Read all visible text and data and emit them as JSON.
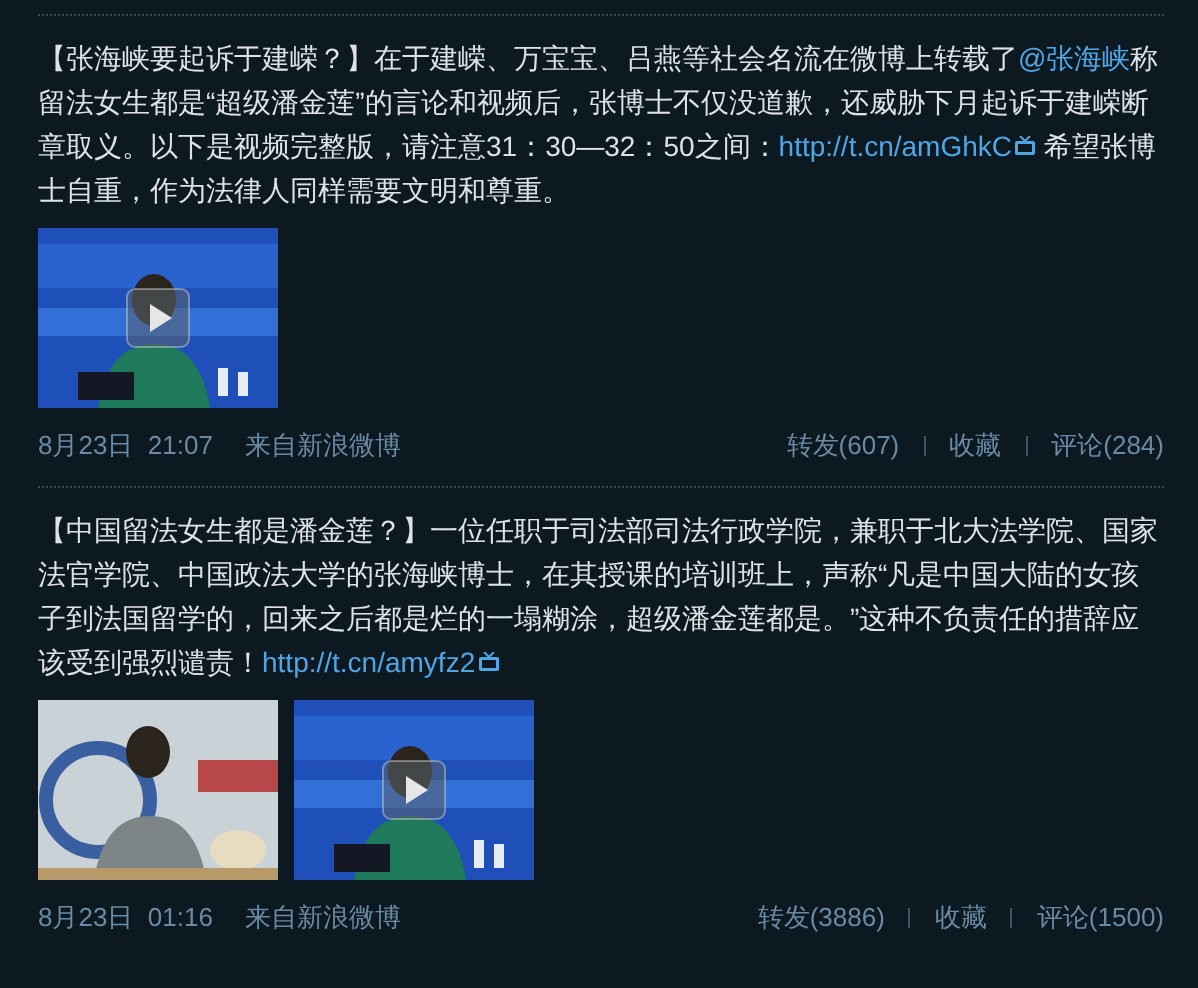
{
  "posts": [
    {
      "text": [
        {
          "kind": "text",
          "text": "【张海峡要起诉于建嵘？】在于建嵘、万宝宝、吕燕等社会名流在微博上转载了"
        },
        {
          "kind": "link",
          "text": "@张海峡"
        },
        {
          "kind": "text",
          "text": "称留法女生都是“超级潘金莲”的言论和视频后，张博士不仅没道歉，还威胁下月起诉于建嵘断章取义。以下是视频完整版，请注意31：30—32：50之间："
        },
        {
          "kind": "video_link",
          "text": "http://t.cn/amGhkC"
        },
        {
          "kind": "text",
          "text": " 希望张博士自重，作为法律人同样需要文明和尊重。"
        }
      ],
      "media": [
        {
          "kind": "video"
        }
      ],
      "date": "8月23日  21:07",
      "source": "来自新浪微博",
      "actions": [
        "转发(607)",
        "收藏",
        "评论(284)"
      ]
    },
    {
      "text": [
        {
          "kind": "text",
          "text": "【中国留法女生都是潘金莲？】一位任职于司法部司法行政学院，兼职于北大法学院、国家法官学院、中国政法大学的张海峡博士，在其授课的培训班上，声称“凡是中国大陆的女孩子到法国留学的，回来之后都是烂的一塌糊涂，超级潘金莲都是。”这种不负责任的措辞应该受到强烈谴责！"
        },
        {
          "kind": "video_link",
          "text": "http://t.cn/amyfz2"
        }
      ],
      "media": [
        {
          "kind": "picture"
        },
        {
          "kind": "video"
        }
      ],
      "date": "8月23日  01:16",
      "source": "来自新浪微博",
      "actions": [
        "转发(3886)",
        "收藏",
        "评论(1500)"
      ]
    }
  ]
}
